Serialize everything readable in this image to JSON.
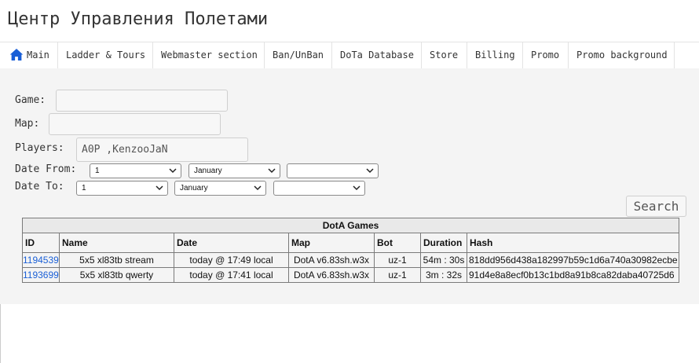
{
  "header": {
    "title": "Центр Управления Полетами"
  },
  "nav": {
    "items": [
      {
        "label": "Main",
        "icon": "home-icon"
      },
      {
        "label": "Ladder & Tours"
      },
      {
        "label": "Webmaster section"
      },
      {
        "label": "Ban/UnBan"
      },
      {
        "label": "DoTa Database"
      },
      {
        "label": "Store"
      },
      {
        "label": "Billing"
      },
      {
        "label": "Promo"
      },
      {
        "label": "Promo background"
      }
    ]
  },
  "form": {
    "game_label": "Game:",
    "game_value": "",
    "map_label": "Map:",
    "map_value": "",
    "players_label": "Players:",
    "players_value": "A0P ,KenzooJaN",
    "date_from_label": "Date From:",
    "date_from": {
      "day": "1",
      "month": "January",
      "year": ""
    },
    "date_to_label": "Date To:",
    "date_to": {
      "day": "1",
      "month": "January",
      "year": ""
    },
    "search_label": "Search"
  },
  "table": {
    "caption": "DotA Games",
    "columns": [
      "ID",
      "Name",
      "Date",
      "Map",
      "Bot",
      "Duration",
      "Hash"
    ],
    "rows": [
      [
        "1194539",
        "5x5 xl83tb stream",
        "today @ 17:49 local",
        "DotA v6.83sh.w3x",
        "uz-1",
        "54m : 30s",
        "818dd956d438a182997b59c1d6a740a30982ecbe"
      ],
      [
        "1193699",
        "5x5 xl83tb qwerty",
        "today @ 17:41 local",
        "DotA v6.83sh.w3x",
        "uz-1",
        "3m : 32s",
        "91d4e8a8ecf0b13c1bd8a91b8ca82daba40725d6"
      ]
    ]
  },
  "colors": {
    "link": "#1a5fd6",
    "panel_bg": "#f4f4f4",
    "icon": "#1a5fd6"
  }
}
